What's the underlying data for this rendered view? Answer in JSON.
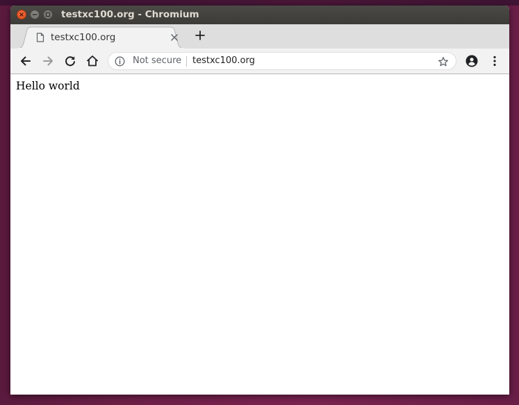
{
  "window": {
    "title": "testxc100.org - Chromium"
  },
  "tabs": [
    {
      "label": "testxc100.org",
      "icon": "page-icon",
      "active": true
    }
  ],
  "toolbar": {
    "buttons": [
      "back-icon",
      "forward-icon",
      "reload-icon",
      "home-icon"
    ],
    "omnibox": {
      "security_label": "Not secure",
      "url": "testxc100.org",
      "info_icon": "info-icon",
      "bookmark_icon": "star-icon"
    },
    "right_buttons": [
      "account-icon",
      "menu-icon"
    ]
  },
  "page": {
    "body_text": "Hello world"
  },
  "colors": {
    "close_button": "#df4a16",
    "titlebar": "#3c3b37",
    "tabstrip": "#dedede",
    "toolbar": "#f2f2f2",
    "desktop": "#6e1f48"
  }
}
